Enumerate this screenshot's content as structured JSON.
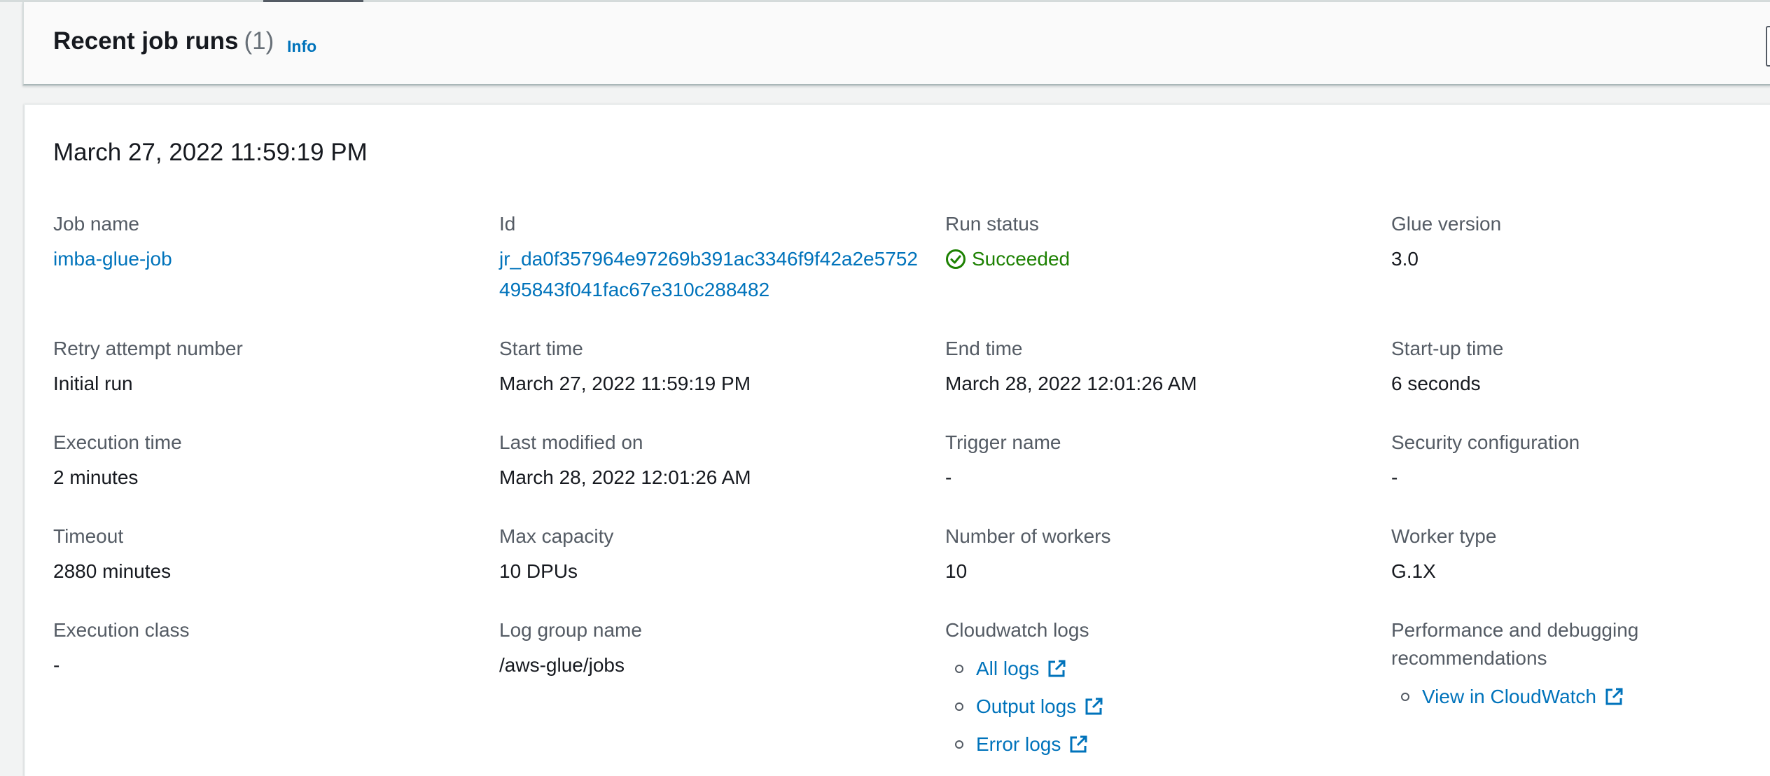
{
  "header": {
    "title": "Recent job runs",
    "count": "(1)",
    "info_label": "Info"
  },
  "run": {
    "title": "March 27, 2022 11:59:19 PM",
    "fields": {
      "job_name": {
        "label": "Job name",
        "value": "imba-glue-job"
      },
      "id": {
        "label": "Id",
        "value": "jr_da0f357964e97269b391ac3346f9f42a2e5752495843f041fac67e310c288482"
      },
      "run_status": {
        "label": "Run status",
        "value": "Succeeded"
      },
      "glue_version": {
        "label": "Glue version",
        "value": "3.0"
      },
      "retry_attempt": {
        "label": "Retry attempt number",
        "value": "Initial run"
      },
      "start_time": {
        "label": "Start time",
        "value": "March 27, 2022 11:59:19 PM"
      },
      "end_time": {
        "label": "End time",
        "value": "March 28, 2022 12:01:26 AM"
      },
      "startup_time": {
        "label": "Start-up time",
        "value": "6 seconds"
      },
      "execution_time": {
        "label": "Execution time",
        "value": "2 minutes"
      },
      "last_modified": {
        "label": "Last modified on",
        "value": "March 28, 2022 12:01:26 AM"
      },
      "trigger_name": {
        "label": "Trigger name",
        "value": "-"
      },
      "security_config": {
        "label": "Security configuration",
        "value": "-"
      },
      "timeout": {
        "label": "Timeout",
        "value": "2880 minutes"
      },
      "max_capacity": {
        "label": "Max capacity",
        "value": "10 DPUs"
      },
      "num_workers": {
        "label": "Number of workers",
        "value": "10"
      },
      "worker_type": {
        "label": "Worker type",
        "value": "G.1X"
      },
      "execution_class": {
        "label": "Execution class",
        "value": "-"
      },
      "log_group": {
        "label": "Log group name",
        "value": "/aws-glue/jobs"
      },
      "cloudwatch_logs": {
        "label": "Cloudwatch logs",
        "links": [
          "All logs",
          "Output logs",
          "Error logs"
        ]
      },
      "perf_debug": {
        "label": "Performance and debugging recommendations",
        "links": [
          "View in CloudWatch"
        ]
      }
    }
  },
  "colors": {
    "link": "#0073bb",
    "success": "#1d8102",
    "label": "#545b64"
  },
  "icons": [
    "refresh-icon",
    "check-circle-icon",
    "external-link-icon"
  ]
}
